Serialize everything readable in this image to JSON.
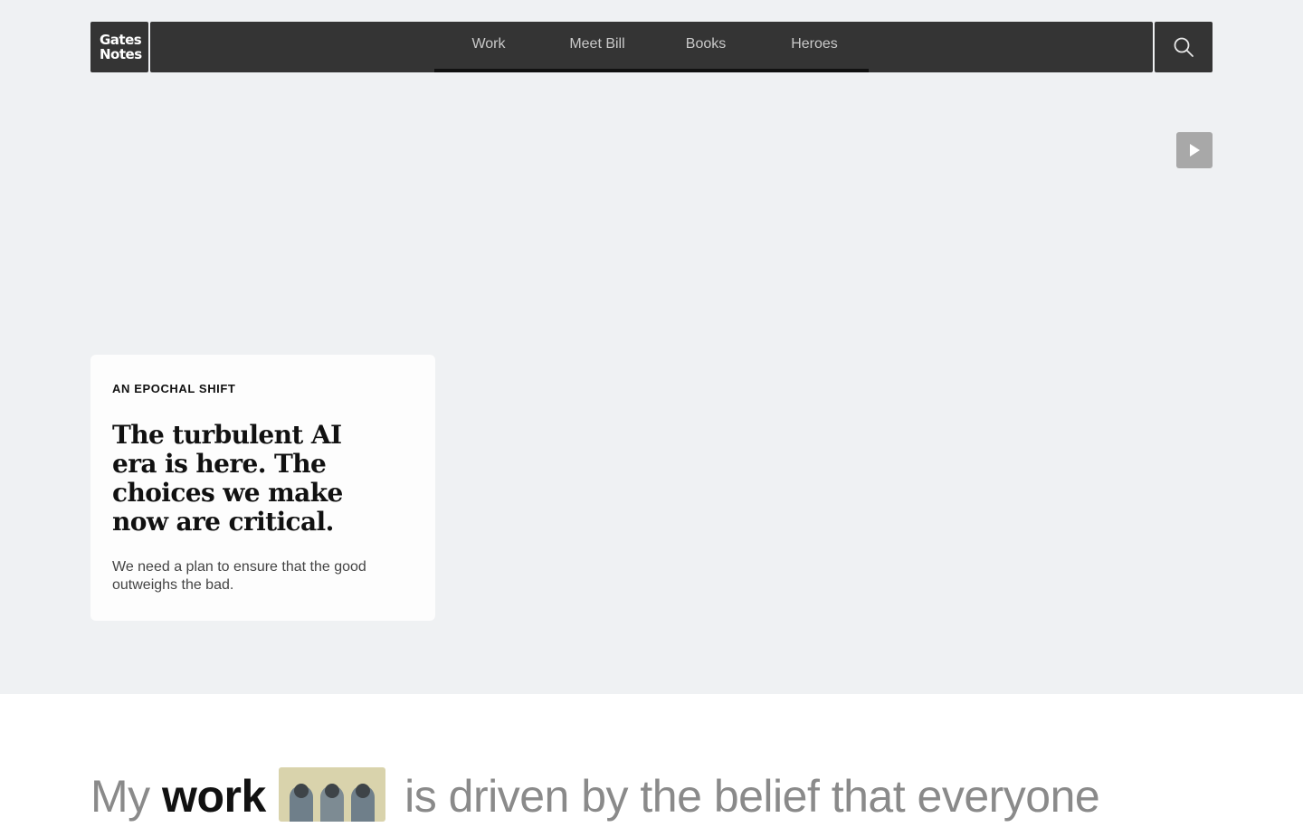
{
  "brand": {
    "logo_line1": "Gates",
    "logo_line2": "Notes"
  },
  "nav": {
    "items": [
      {
        "label": "Work"
      },
      {
        "label": "Meet Bill"
      },
      {
        "label": "Books"
      },
      {
        "label": "Heroes"
      }
    ],
    "search_icon": "search-icon"
  },
  "hero": {
    "play_icon": "play-icon",
    "eyebrow": "AN EPOCHAL SHIFT",
    "headline": "The turbulent AI era is here. The choices we make now are critical.",
    "dek": "We need a plan to ensure that the good outweighs the bad."
  },
  "intro": {
    "text_before": "My ",
    "text_emphasis": "work",
    "text_after": " is driven by the belief that everyone"
  },
  "colors": {
    "nav_bg": "#343434",
    "hero_bg": "#eff1f3",
    "card_bg": "#fdfdfd"
  }
}
